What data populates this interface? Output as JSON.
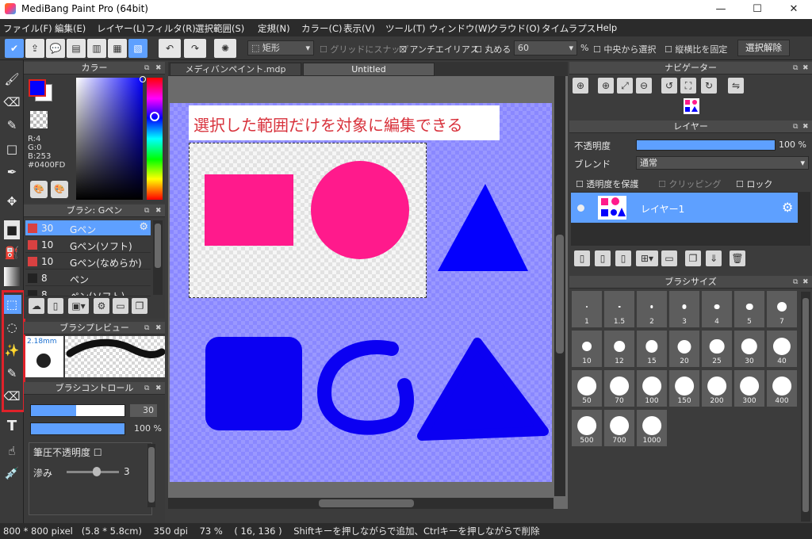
{
  "window": {
    "title": "MediBang Paint Pro (64bit)",
    "minimize": "—",
    "maximize": "☐",
    "close": "✕"
  },
  "menu": [
    "ファイル(F)",
    "編集(E)",
    "レイヤー(L)",
    "フィルタ(R)",
    "選択範囲(S)",
    "定規(N)",
    "カラー(C)",
    "表示(V)",
    "ツール(T)",
    "ウィンドウ(W)",
    "クラウド(O)",
    "タイムラプス",
    "Help"
  ],
  "toolbar": {
    "shape_value": "矩形",
    "grid_snap": "グリッドにスナップ",
    "antialias": "アンチエイリアス",
    "rounded": "丸める",
    "rounded_value": "60",
    "percent": "%",
    "from_center": "中央から選択",
    "fix_ratio": "縦横比を固定",
    "deselect": "選択解除"
  },
  "color_panel": {
    "title": "カラー",
    "r": "R:4",
    "g": "G:0",
    "b": "B:253",
    "hex": "#0400FD",
    "fg": "#0400fd",
    "bg": "#ffffff"
  },
  "brush_panel": {
    "title": "ブラシ: Gペン",
    "items": [
      {
        "size": "30",
        "name": "Gペン"
      },
      {
        "size": "10",
        "name": "Gペン(ソフト)"
      },
      {
        "size": "10",
        "name": "Gペン(なめらか)"
      },
      {
        "size": "8",
        "name": "ペン"
      },
      {
        "size": "8",
        "name": "ペン(ソフト)"
      }
    ]
  },
  "brush_preview": {
    "title": "ブラシプレビュー",
    "size": "2.18mm"
  },
  "brush_control": {
    "title": "ブラシコントロール",
    "size_value": "30",
    "opacity_value": "100",
    "opacity_unit": "%",
    "pressure_opacity": "筆圧不透明度",
    "blur_label": "滲み",
    "blur_value": "3",
    "size_level": 0.48
  },
  "tabs": [
    "メディバンペイント.mdp",
    "Untitled"
  ],
  "canvas": {
    "banner": "選択した範囲だけを対象に編集できる"
  },
  "navigator": {
    "title": "ナビゲーター"
  },
  "layer_panel": {
    "title": "レイヤー",
    "opacity_label": "不透明度",
    "opacity_value": "100 %",
    "blend_label": "ブレンド",
    "blend_value": "通常",
    "protect_alpha": "透明度を保護",
    "clipping": "クリッピング",
    "lock": "ロック",
    "layer_name": "レイヤー1"
  },
  "brush_size_panel": {
    "title": "ブラシサイズ",
    "sizes": [
      "1",
      "1.5",
      "2",
      "3",
      "4",
      "5",
      "7",
      "10",
      "12",
      "15",
      "20",
      "25",
      "30",
      "40",
      "50",
      "70",
      "100",
      "150",
      "200",
      "300",
      "400",
      "500",
      "700",
      "1000"
    ]
  },
  "status": "800 * 800 pixel   (5.8 * 5.8cm)    350 dpi    73 %    ( 16, 136 )    Shiftキーを押しながらで追加、Ctrlキーを押しながらで削除"
}
